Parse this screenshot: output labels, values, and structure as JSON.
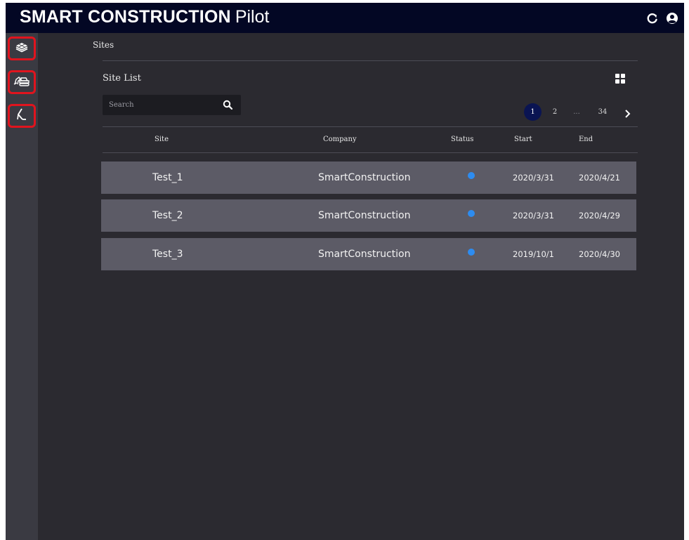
{
  "app": {
    "brand_bold": "SMART CONSTRUCTION",
    "brand_light": "Pilot",
    "refresh_icon": "refresh-icon",
    "user_icon": "user-circle-icon"
  },
  "sidebar": {
    "items": [
      {
        "icon": "layers-icon"
      },
      {
        "icon": "excavator-icon"
      },
      {
        "icon": "boom-arm-icon"
      }
    ]
  },
  "breadcrumb": "Sites",
  "site_list": {
    "title": "Site List",
    "view_icon": "grid-view-icon",
    "search": {
      "value": "",
      "placeholder": "Search"
    },
    "pagination": {
      "pages": [
        "1",
        "2",
        "...",
        "34"
      ],
      "current": "1",
      "next_icon": "chevron-right-icon"
    },
    "columns": [
      "Site",
      "Company",
      "Status",
      "Start",
      "End"
    ],
    "rows": [
      {
        "site": "Test_1",
        "company": "SmartConstruction",
        "status_color": "#2d8cf0",
        "start": "2020/3/31",
        "end": "2020/4/21"
      },
      {
        "site": "Test_2",
        "company": "SmartConstruction",
        "status_color": "#2d8cf0",
        "start": "2020/3/31",
        "end": "2020/4/29"
      },
      {
        "site": "Test_3",
        "company": "SmartConstruction",
        "status_color": "#2d8cf0",
        "start": "2019/10/1",
        "end": "2020/4/30"
      }
    ]
  },
  "colors": {
    "topbar": "#030724",
    "background": "#2b2a30",
    "sidebar": "#3a3a42",
    "row": "#5c5b66",
    "highlight": "#e0141e",
    "active_page": "#0a1452"
  }
}
